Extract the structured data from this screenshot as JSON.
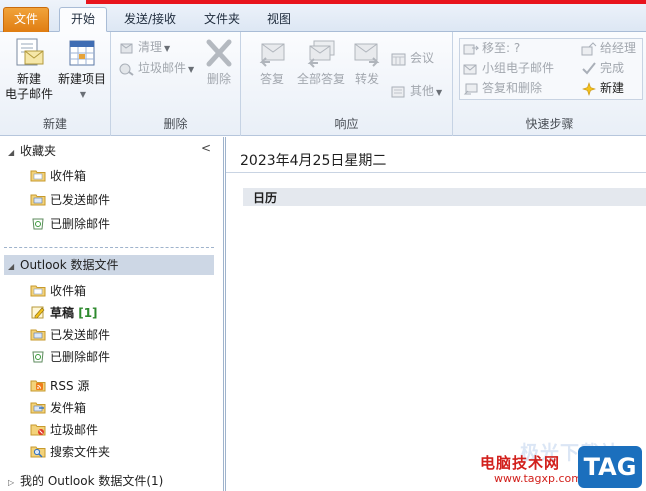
{
  "tabs": {
    "file": "文件",
    "home": "开始",
    "send_receive": "发送/接收",
    "folder": "文件夹",
    "view": "视图"
  },
  "ribbon": {
    "new_group": {
      "new_email_line1": "新建",
      "new_email_line2": "电子邮件",
      "new_items": "新建项目",
      "label": "新建"
    },
    "delete_group": {
      "clean_up": "清理",
      "junk": "垃圾邮件",
      "delete": "删除",
      "label": "删除"
    },
    "respond_group": {
      "reply": "答复",
      "reply_all": "全部答复",
      "forward": "转发",
      "meeting": "会议",
      "more": "其他",
      "label": "响应"
    },
    "quick_steps_group": {
      "move_to": "移至: ?",
      "team_email": "小组电子邮件",
      "reply_delete": "答复和删除",
      "to_manager": "给经理",
      "done": "完成",
      "create_new": "新建",
      "label": "快速步骤"
    }
  },
  "nav": {
    "favorites_header": "收藏夹",
    "favorites": [
      {
        "label": "收件箱"
      },
      {
        "label": "已发送邮件"
      },
      {
        "label": "已删除邮件"
      }
    ],
    "data_file_header": "Outlook 数据文件",
    "folders": [
      {
        "label": "收件箱"
      },
      {
        "label": "草稿",
        "count": "[1]"
      },
      {
        "label": "已发送邮件"
      },
      {
        "label": "已删除邮件"
      },
      {
        "label": "RSS 源"
      },
      {
        "label": "发件箱"
      },
      {
        "label": "垃圾邮件"
      },
      {
        "label": "搜索文件夹"
      }
    ],
    "my_data_file": "我的 Outlook 数据文件(1)"
  },
  "main": {
    "date": "2023年4月25日星期二",
    "calendar_label": "日历"
  },
  "watermark": {
    "faint_text": "极光下载站",
    "site_name": "电脑技术网",
    "url": "www.tagxp.com",
    "tag": "TAG"
  },
  "colors": {
    "file_tab": "#e8891c",
    "red_strip": "#e8141c",
    "selection": "#cdd7e5",
    "watermark_red": "#d2201c",
    "watermark_blue": "#1b6fbd"
  }
}
